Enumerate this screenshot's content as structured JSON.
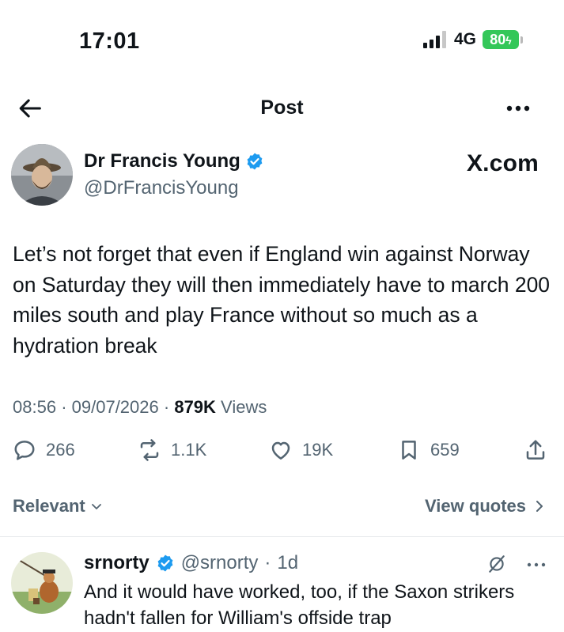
{
  "status_bar": {
    "time": "17:01",
    "network": "4G",
    "battery": "80",
    "battery_color": "#34c759"
  },
  "header": {
    "title": "Post",
    "back_icon": "arrow-left-icon",
    "more_icon": "more-horizontal-icon"
  },
  "post": {
    "author": {
      "name": "Dr Francis Young",
      "handle": "@DrFrancisYoung",
      "verified": true
    },
    "brand": "X.com",
    "text": "Let’s not forget that even if England win against Norway on Saturday they will then immediately have to march 200 miles south and play France without so much as a hydration break",
    "time": "08:56",
    "date": "09/07/2026",
    "views_count": "879K",
    "views_label": "Views",
    "stats": {
      "replies": "266",
      "reposts": "1.1K",
      "likes": "19K",
      "bookmarks": "659"
    }
  },
  "sort": {
    "label": "Relevant",
    "view_quotes": "View quotes"
  },
  "reply": {
    "name": "srnorty",
    "handle": "@srnorty",
    "age": "1d",
    "verified": true,
    "text": "And it would have worked, too, if the Saxon strikers hadn't fallen for William's offside trap"
  },
  "colors": {
    "text": "#0f1419",
    "secondary": "#536471",
    "verified": "#1d9bf0"
  }
}
